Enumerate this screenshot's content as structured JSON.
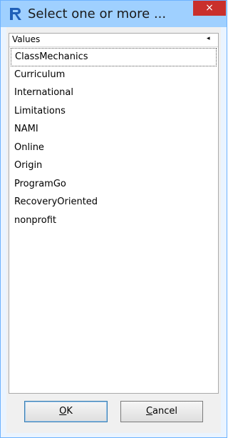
{
  "window": {
    "title": "Select one or more ...",
    "close_symbol": "×",
    "app_icon": "r-logo-icon"
  },
  "list": {
    "header": "Values",
    "header_arrow": "◂",
    "items": [
      "ClassMechanics",
      "Curriculum",
      "International",
      "Limitations",
      "NAMI",
      "Online",
      "Origin",
      "ProgramGo",
      "RecoveryOriented",
      "nonprofit"
    ]
  },
  "buttons": {
    "ok_mnemonic": "O",
    "ok_rest": "K",
    "cancel_mnemonic": "C",
    "cancel_rest": "ancel"
  },
  "colors": {
    "titlebar": "#9fd0ff",
    "close": "#c9302c",
    "r_logo": "#1f5fb8"
  }
}
